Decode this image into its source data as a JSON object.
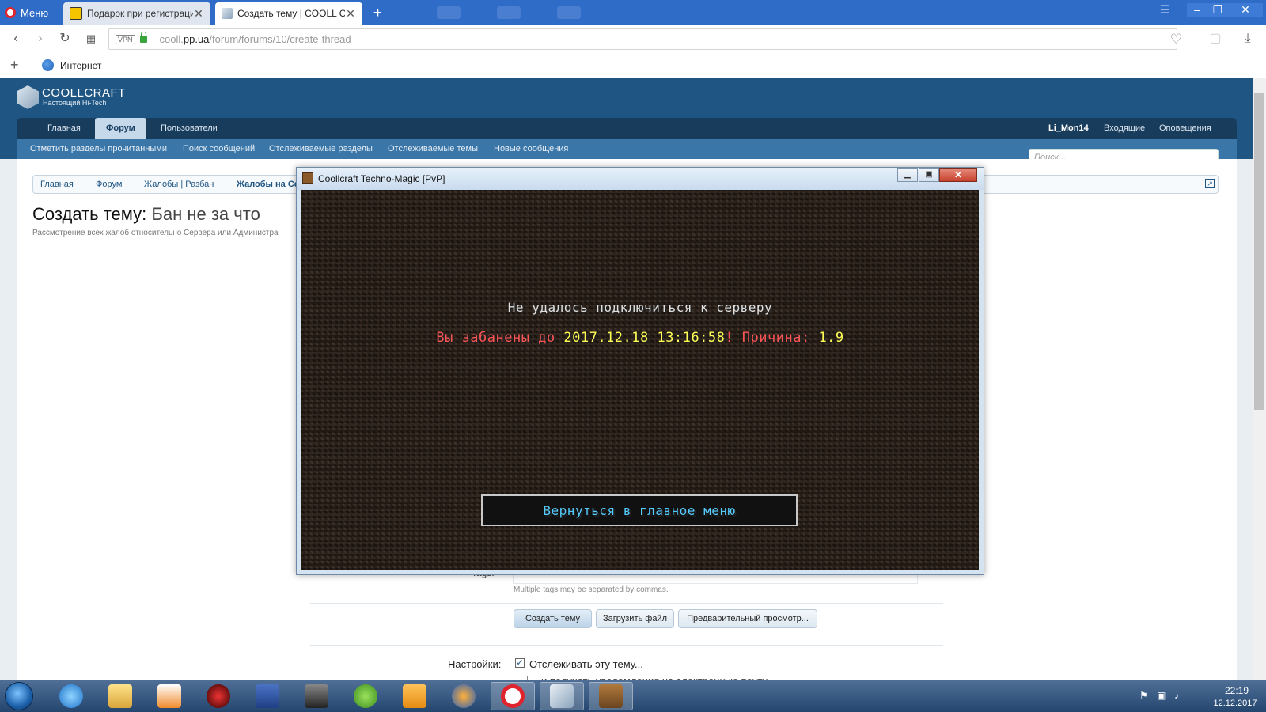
{
  "browser": {
    "menu_label": "Меню",
    "tabs": [
      {
        "title": "Подарок при регистраци",
        "active": false
      },
      {
        "title": "Создать тему | COOLL CR/",
        "active": true
      }
    ],
    "url_prefix": "cooll.",
    "url_domain": "pp.ua",
    "url_path": "/forum/forums/10/create-thread",
    "vpn_label": "VPN",
    "bookmark_label": "Интернет"
  },
  "site": {
    "logo_title": "COOLLCRAFT",
    "logo_subtitle": "Настоящий Hi-Tech",
    "nav": [
      "Главная",
      "Форум",
      "Пользователи"
    ],
    "nav_active": "Форум",
    "user": "Li_Mon14",
    "inbox": "Входящие",
    "alerts": "Оповещения",
    "subnav": [
      "Отметить разделы прочитанными",
      "Поиск сообщений",
      "Отслеживаемые разделы",
      "Отслеживаемые темы",
      "Новые сообщения"
    ],
    "search_placeholder": "Поиск..."
  },
  "page": {
    "breadcrumbs": [
      "Главная",
      "Форум",
      "Жалобы | Разбан",
      "Жалобы на Се"
    ],
    "title_prefix": "Создать тему:",
    "title_topic": "Бан не за что",
    "description": "Рассмотрение всех жалоб относительно Сервера или Администра",
    "tags_label": "Tags:",
    "tags_hint": "Multiple tags may be separated by commas.",
    "buttons": {
      "create": "Создать тему",
      "upload": "Загрузить файл",
      "preview": "Предварительный просмотр..."
    },
    "settings_label": "Настройки:",
    "watch_label": "Отслеживать эту тему...",
    "watch_checked": true,
    "email_label": "и получать уведомления на электронную почту"
  },
  "minecraft": {
    "window_title": "Coollcraft Techno-Magic [PvP]",
    "error_title": "Не удалось подключиться к серверу",
    "ban_prefix": "Вы забанены до ",
    "ban_until": "2017.12.18 13:16:58",
    "ban_mid": "! Причина: ",
    "ban_reason": "1.9",
    "button_label": "Вернуться в главное меню"
  },
  "taskbar": {
    "time": "22:19",
    "date": "12.12.2017"
  },
  "colors": {
    "forum_header": "#1f5582",
    "mc_red": "#ff5555",
    "mc_yellow": "#ffff55",
    "mc_button_text": "#55ccff"
  }
}
